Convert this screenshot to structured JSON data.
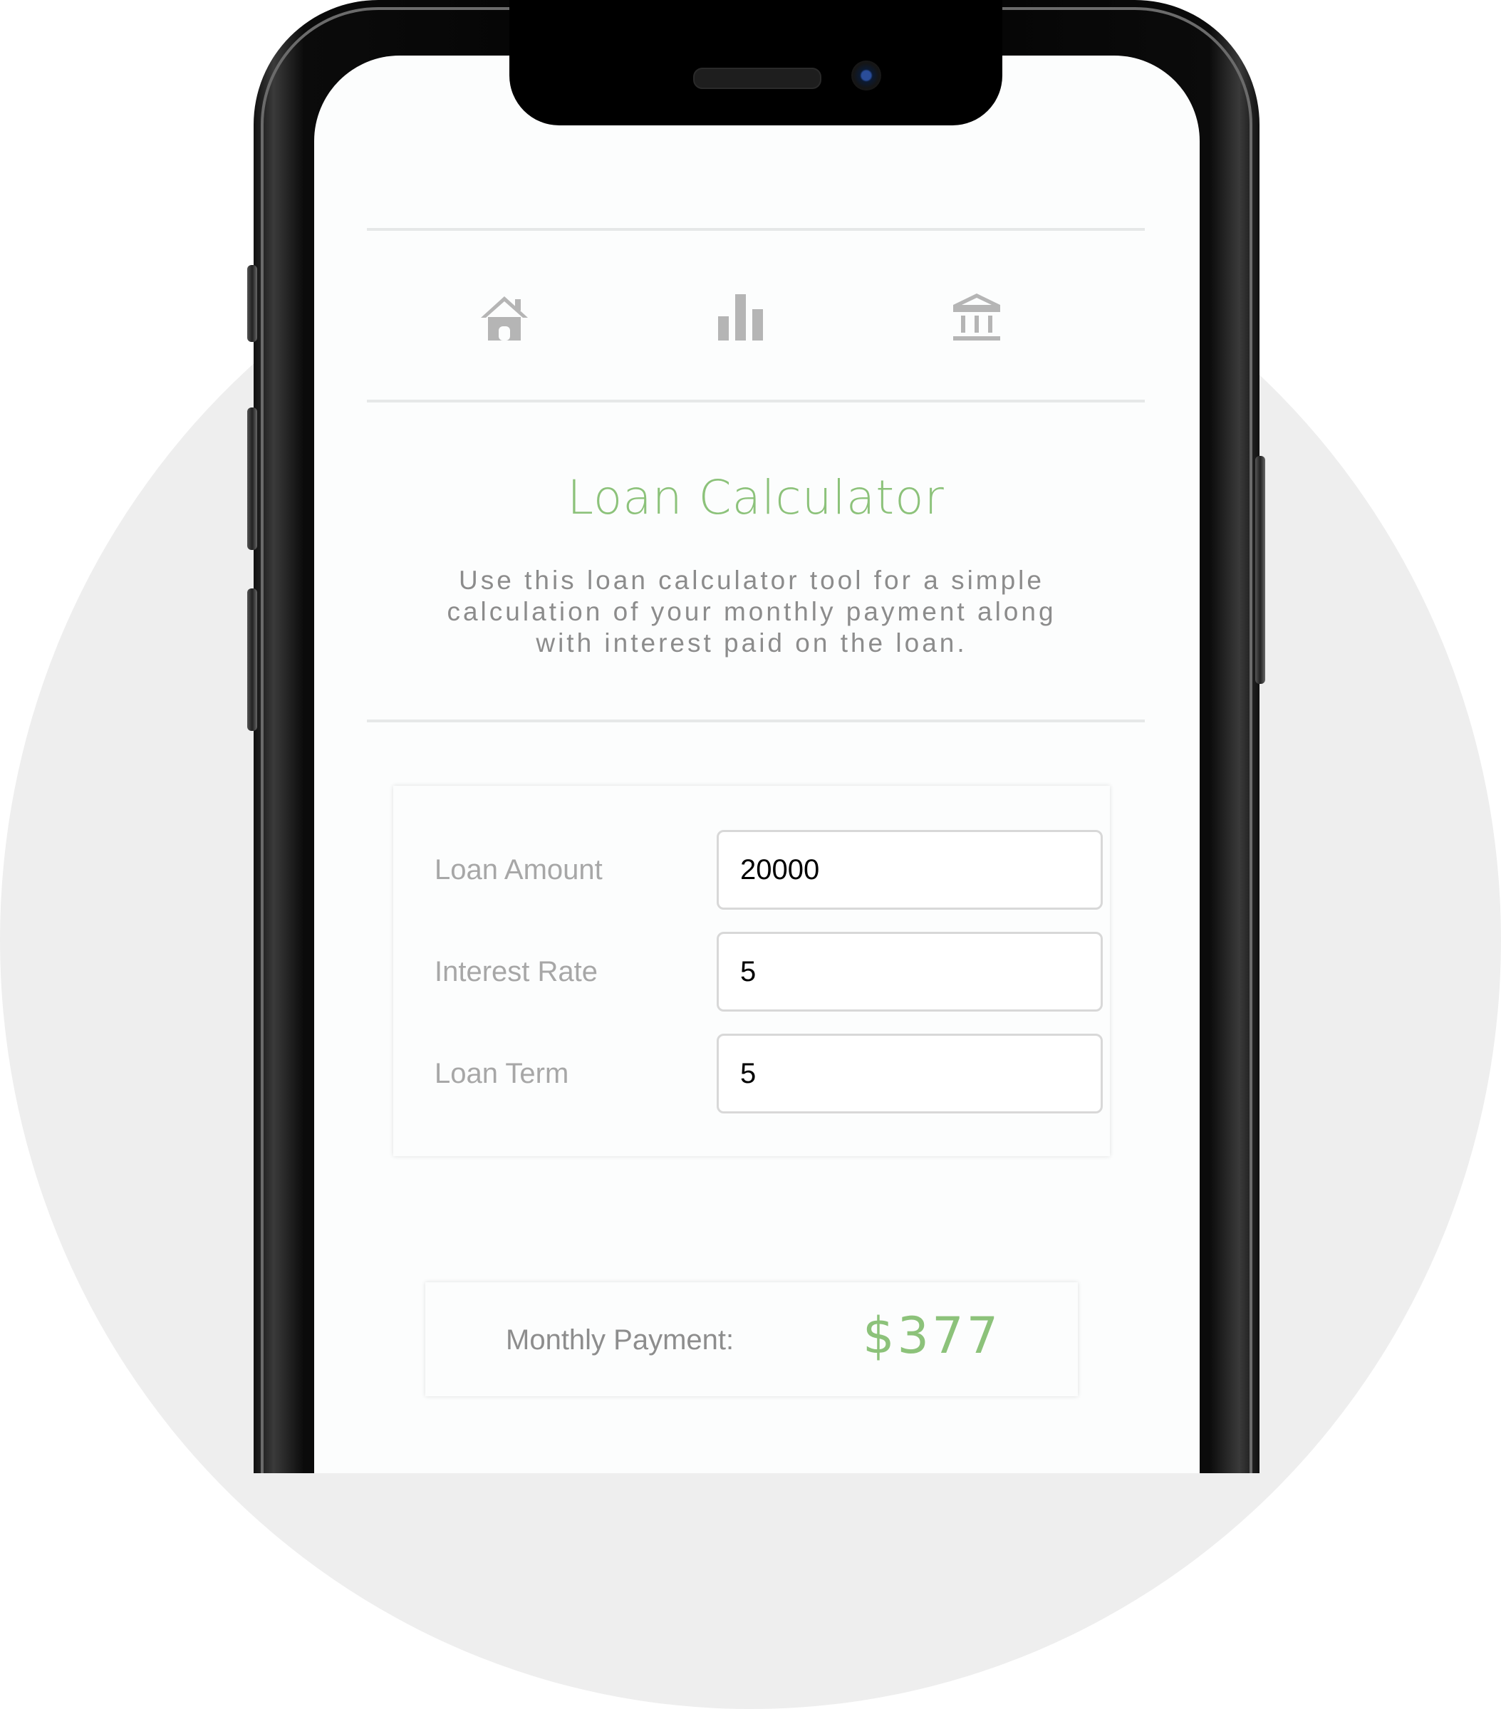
{
  "nav": {
    "items": [
      {
        "icon": "home-icon"
      },
      {
        "icon": "bar-chart-icon"
      },
      {
        "icon": "bank-icon"
      }
    ]
  },
  "page": {
    "title": "Loan Calculator",
    "description": "Use this loan calculator tool for a simple calculation of your monthly payment along with interest paid on the loan."
  },
  "form": {
    "fields": [
      {
        "label": "Loan Amount",
        "value": "20000"
      },
      {
        "label": "Interest Rate",
        "value": "5"
      },
      {
        "label": "Loan Term",
        "value": "5"
      }
    ]
  },
  "result": {
    "label": "Monthly Payment:",
    "value": "$377"
  },
  "colors": {
    "accent": "#8cc27a",
    "icon": "#b5b5b5",
    "background_circle": "#eeeeee"
  }
}
